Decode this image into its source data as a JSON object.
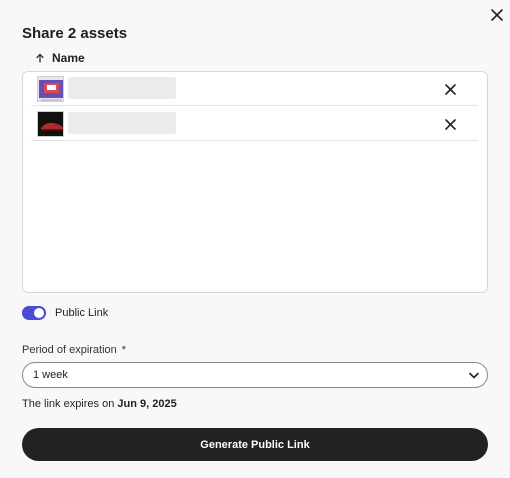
{
  "dialog": {
    "title": "Share 2 assets",
    "close_icon": "close-icon"
  },
  "table": {
    "sort_icon": "arrow-up-icon",
    "name_header": "Name"
  },
  "assets": [
    {
      "thumbnail_icon": "image-thumbnail-poster",
      "remove_icon": "close-icon"
    },
    {
      "thumbnail_icon": "image-thumbnail-car",
      "remove_icon": "close-icon"
    }
  ],
  "public_link": {
    "label": "Public Link",
    "enabled": true,
    "toggle_color": "#4b4bd6"
  },
  "expiration": {
    "label": "Period of expiration",
    "required_mark": "*",
    "selected": "1 week",
    "chevron_icon": "chevron-down-icon",
    "expires_prefix": "The link expires on",
    "expires_date": "Jun 9, 2025"
  },
  "actions": {
    "generate_label": "Generate Public Link",
    "button_color": "#222222"
  }
}
